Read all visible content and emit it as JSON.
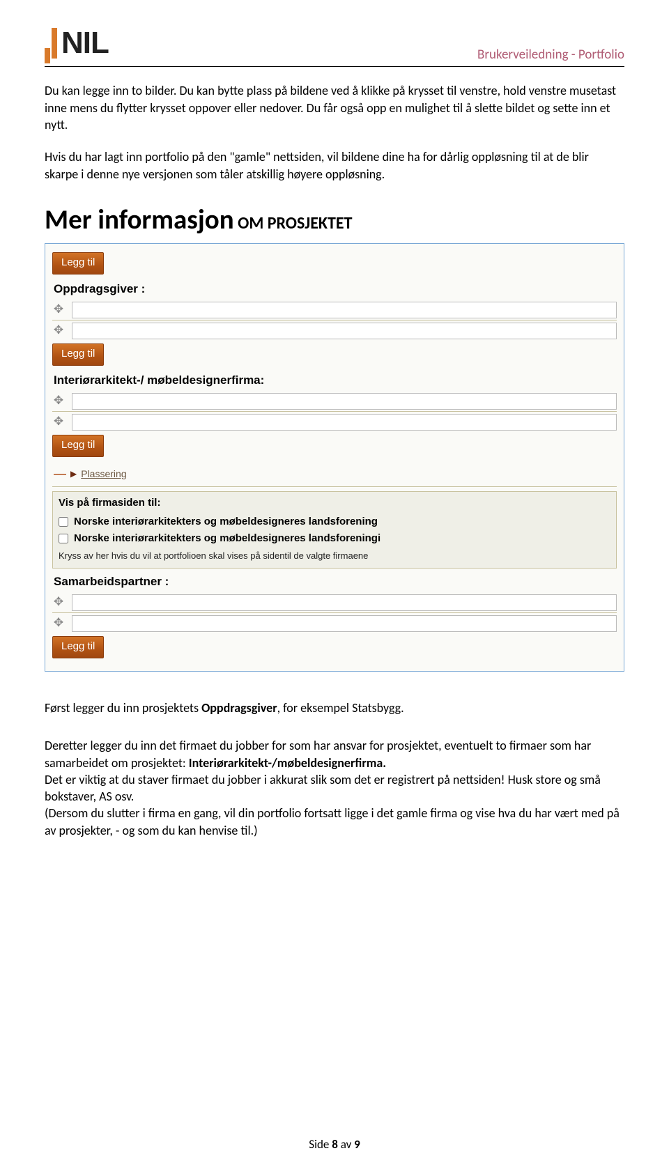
{
  "header": {
    "logo_text": "NIL",
    "right": "Brukerveiledning - Portfolio"
  },
  "intro": {
    "p1": "Du kan legge inn to bilder. Du kan bytte plass på bildene ved å klikke på krysset til venstre, hold venstre musetast inne mens du flytter krysset oppover eller nedover. Du får også opp en mulighet til å slette bildet og sette inn et nytt.",
    "p2": "Hvis du har lagt inn portfolio på den \"gamle\" nettsiden, vil bildene dine ha for dårlig oppløsning til at de blir skarpe i denne nye versjonen som tåler atskillig høyere oppløsning."
  },
  "heading": {
    "main": "Mer informasjon",
    "sub": " OM PROSJEKTET"
  },
  "form": {
    "legg_til": "Legg til",
    "labels": {
      "oppdragsgiver": "Oppdragsgiver :",
      "firma": "Interiørarkitekt-/ møbeldesignerfirma:",
      "plassering": "Plassering",
      "vis_paa": "Vis på firmasiden til:",
      "samarbeidspartner": "Samarbeidspartner :"
    },
    "checkboxes": [
      "Norske interiørarkitekters og møbeldesigneres landsforening",
      "Norske interiørarkitekters og møbeldesigneres landsforeningi"
    ],
    "firm_note": "Kryss av her hvis du vil at portfolioen skal vises på sidentil de valgte firmaene"
  },
  "closing": {
    "p3a": "Først legger du inn prosjektets ",
    "p3b": "Oppdragsgiver",
    "p3c": ", for eksempel Statsbygg.",
    "p4a": "Deretter legger du inn det firmaet  du jobber for som har ansvar for prosjektet, eventuelt to firmaer som har samarbeidet om prosjektet: ",
    "p4b": "Interiørarkitekt-/møbeldesignerfirma.",
    "p5": "Det er viktig at du staver firmaet du jobber i akkurat slik som det er registrert på nettsiden! Husk store og små bokstaver, AS osv.",
    "p6": "(Dersom du slutter i firma en gang, vil din portfolio fortsatt ligge i det gamle firma og vise hva du har vært med på av prosjekter, - og som du kan henvise til.)"
  },
  "footer": {
    "a": "Side ",
    "b": "8",
    "c": " av ",
    "d": "9"
  }
}
